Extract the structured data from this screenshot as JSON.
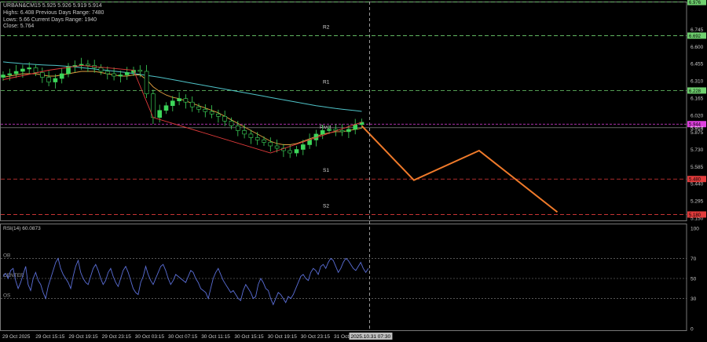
{
  "header": {
    "symbol_line": "URBAN&CM15  5.925 5.926 5.919 5.914",
    "line1": "Highs: 6.408   Previous Days Range: 7480",
    "line2": "Lows: 5.66   Current Days Range: 1940",
    "line3": "Close: 5.764"
  },
  "chart_data": [
    {
      "type": "line",
      "name_hint": "price panel",
      "ylim": [
        5.13,
        6.98
      ],
      "y_ticks": [
        "6.976",
        "6.745",
        "6.600",
        "6.455",
        "6.310",
        "6.165",
        "6.020",
        "5.875",
        "5.730",
        "5.585",
        "5.440",
        "5.295",
        "5.150"
      ],
      "x_ticks": [
        "29 Oct 2025",
        "29 Oct 15:15",
        "29 Oct 19:15",
        "29 Oct 23:15",
        "30 Oct 03:15",
        "30 Oct 07:15",
        "30 Oct 11:15",
        "30 Oct 15:15",
        "30 Oct 19:15",
        "30 Oct 23:15",
        "31 Oct"
      ],
      "x_current_label": "2025.10.31 07:30",
      "levels": [
        {
          "label": "R2",
          "value": 6.692,
          "tag": "6.692",
          "color": "#6fd16f"
        },
        {
          "label": "R1",
          "value": 6.228,
          "tag": "6.228",
          "color": "#6fd16f"
        },
        {
          "label": "Pivot",
          "value": 5.944,
          "tag": "5.944",
          "color": "#e040e0"
        },
        {
          "label": "S1",
          "value": 5.48,
          "tag": "5.480",
          "color": "#e23b3b"
        },
        {
          "label": "S2",
          "value": 5.18,
          "tag": "5.180",
          "color": "#e23b3b"
        }
      ],
      "top_tag": {
        "value": 6.976,
        "tag": "6.976",
        "color": "#6fd16f"
      },
      "bid_tag": {
        "value": 5.914,
        "tag": "5.914"
      },
      "close_series": [
        6.36,
        6.37,
        6.39,
        6.41,
        6.42,
        6.38,
        6.34,
        6.3,
        6.33,
        6.37,
        6.43,
        6.44,
        6.45,
        6.44,
        6.42,
        6.39,
        6.37,
        6.35,
        6.36,
        6.38,
        6.4,
        6.39,
        6.2,
        6.0,
        6.06,
        6.1,
        6.14,
        6.16,
        6.13,
        6.09,
        6.07,
        6.05,
        6.03,
        6.01,
        5.97,
        5.93,
        5.89,
        5.86,
        5.83,
        5.81,
        5.79,
        5.76,
        5.74,
        5.72,
        5.7,
        5.73,
        5.77,
        5.81,
        5.86,
        5.89,
        5.9,
        5.89,
        5.88,
        5.9,
        5.94,
        5.96
      ],
      "ma_slow": [
        6.47,
        6.465,
        6.46,
        6.455,
        6.452,
        6.448,
        6.445,
        6.442,
        6.44,
        6.436,
        6.432,
        6.428,
        6.422,
        6.416,
        6.41,
        6.404,
        6.398,
        6.392,
        6.386,
        6.38,
        6.372,
        6.364,
        6.356,
        6.348,
        6.34,
        6.33,
        6.32,
        6.31,
        6.3,
        6.29,
        6.28,
        6.27,
        6.26,
        6.25,
        6.24,
        6.23,
        6.22,
        6.21,
        6.2,
        6.19,
        6.18,
        6.17,
        6.16,
        6.15,
        6.14,
        6.13,
        6.12,
        6.11,
        6.1,
        6.092,
        6.084,
        6.076,
        6.07,
        6.064,
        6.058,
        6.052
      ],
      "ma_fast": [
        6.34,
        6.35,
        6.36,
        6.37,
        6.37,
        6.37,
        6.36,
        6.35,
        6.35,
        6.36,
        6.37,
        6.38,
        6.39,
        6.39,
        6.39,
        6.38,
        6.37,
        6.36,
        6.35,
        6.35,
        6.36,
        6.36,
        6.32,
        6.26,
        6.22,
        6.19,
        6.17,
        6.16,
        6.14,
        6.12,
        6.1,
        6.08,
        6.06,
        6.04,
        6.01,
        5.98,
        5.95,
        5.92,
        5.89,
        5.86,
        5.83,
        5.8,
        5.78,
        5.77,
        5.77,
        5.78,
        5.8,
        5.82,
        5.84,
        5.86,
        5.87,
        5.88,
        5.88,
        5.89,
        5.9,
        5.91
      ],
      "zigzag": [
        [
          0,
          6.32
        ],
        [
          7,
          6.4
        ],
        [
          12,
          6.44
        ],
        [
          20,
          6.4
        ],
        [
          23,
          6.0
        ],
        [
          41,
          5.7
        ],
        [
          55,
          5.96
        ]
      ],
      "forecast": [
        [
          55,
          5.93
        ],
        [
          63,
          5.47
        ],
        [
          73,
          5.72
        ],
        [
          85,
          5.2
        ]
      ],
      "colors": {
        "up": "#3dd65a",
        "down": "#3dd65a",
        "ma_slow": "#4fc3c8",
        "ma_fast": "#e2a040",
        "zigzag": "#e23b3b",
        "forecast": "#f07a2a",
        "grid": "#3a3a3a",
        "axis_text": "#c8c8c8"
      }
    },
    {
      "type": "line",
      "name_hint": "rsi panel",
      "title": "RSI(14) 60.0873",
      "ylim": [
        0,
        100
      ],
      "y_ticks": [
        "100",
        "70",
        "50",
        "30",
        "0"
      ],
      "levels": [
        {
          "label": "OB",
          "value": 70
        },
        {
          "label": "CENTER",
          "value": 50
        },
        {
          "label": "OS",
          "value": 30
        }
      ],
      "values": [
        52,
        55,
        50,
        58,
        60,
        48,
        40,
        46,
        54,
        62,
        44,
        38,
        50,
        56,
        48,
        44,
        36,
        30,
        42,
        50,
        58,
        66,
        70,
        60,
        54,
        50,
        46,
        40,
        52,
        62,
        68,
        56,
        50,
        46,
        44,
        52,
        60,
        64,
        58,
        50,
        44,
        48,
        56,
        60,
        52,
        46,
        42,
        50,
        58,
        62,
        56,
        48,
        40,
        36,
        34,
        46,
        52,
        62,
        54,
        48,
        44,
        50,
        56,
        62,
        64,
        58,
        50,
        44,
        48,
        54,
        52,
        50,
        48,
        46,
        52,
        58,
        56,
        50,
        46,
        40,
        38,
        36,
        30,
        40,
        50,
        56,
        60,
        54,
        48,
        44,
        40,
        36,
        38,
        34,
        30,
        28,
        38,
        44,
        40,
        36,
        30,
        32,
        44,
        50,
        46,
        40,
        38,
        30,
        24,
        30,
        36,
        34,
        30,
        26,
        32,
        30,
        34,
        40,
        46,
        52,
        54,
        50,
        48,
        56,
        60,
        58,
        54,
        62,
        64,
        60,
        66,
        70,
        68,
        62,
        56,
        60,
        66,
        70,
        68,
        64,
        60,
        58,
        62,
        66,
        60,
        56,
        60
      ],
      "color": "#5b6fd8"
    }
  ]
}
